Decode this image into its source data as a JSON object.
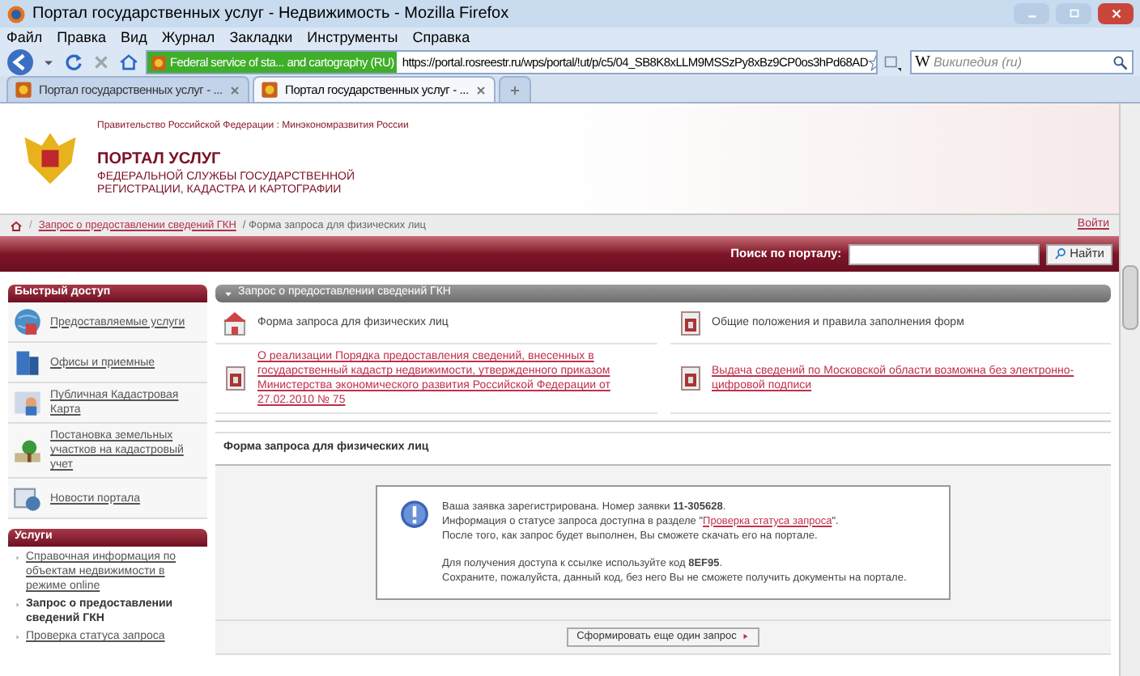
{
  "window": {
    "title": "Портал государственных услуг - Недвижимость - Mozilla Firefox"
  },
  "menu": [
    "Файл",
    "Правка",
    "Вид",
    "Журнал",
    "Закладки",
    "Инструменты",
    "Справка"
  ],
  "navbar": {
    "identity": "Federal service of sta... and cartography (RU)",
    "url": "https://portal.rosreestr.ru/wps/portal/!ut/p/c5/04_SB8K8xLLM9MSSzPy8xBz9CP0os3hPd68AD",
    "search_engine": "W",
    "search_placeholder": "Википедия (ru)"
  },
  "tabs": [
    {
      "label": "Портал государственных услуг - ...",
      "selected": false
    },
    {
      "label": "Портал государственных услуг - ...",
      "selected": true
    }
  ],
  "header": {
    "top_line": "Правительство Российской Федерации : Минэкономразвития России",
    "title": "ПОРТАЛ УСЛУГ",
    "subtitle": "ФЕДЕРАЛЬНОЙ СЛУЖБЫ ГОСУДАРСТВЕННОЙ РЕГИСТРАЦИИ, КАДАСТРА И КАРТОГРАФИИ"
  },
  "breadcrumb": {
    "separator": "/",
    "link": "Запрос о предоставлении сведений ГКН",
    "current": "/ Форма запроса для физических лиц",
    "login": "Войти"
  },
  "portal_search": {
    "label": "Поиск по порталу:",
    "button": "Найти"
  },
  "quick_access": {
    "title": "Быстрый доступ",
    "items": [
      {
        "label": "Предоставляемые услуги",
        "kind": "globe"
      },
      {
        "label": "Офисы и приемные",
        "kind": "building"
      },
      {
        "label": "Публичная Кадастровая Карта",
        "kind": "map"
      },
      {
        "label": "Постановка земельных участков на кадастровый учет",
        "kind": "tree"
      },
      {
        "label": "Новости портала",
        "kind": "news"
      }
    ]
  },
  "services": {
    "title": "Услуги",
    "items": [
      {
        "label": "Справочная информация по объектам недвижимости в режиме online",
        "selected": false
      },
      {
        "label": "Запрос о предоставлении сведений ГКН",
        "selected": true
      },
      {
        "label": "Проверка статуса запроса",
        "selected": false
      }
    ]
  },
  "section": {
    "title": "Запрос о предоставлении сведений ГКН",
    "links": [
      {
        "label": "Форма запроса для физических лиц",
        "kind": "house",
        "link": false
      },
      {
        "label": "Общие положения и правила заполнения форм",
        "kind": "doc",
        "link": false
      },
      {
        "label": "О реализации Порядка предоставления сведений, внесенных в государственный кадастр недвижимости, утвержденного приказом Министерства экономического развития Российской Федерации от 27.02.2010 № 75",
        "kind": "doc",
        "link": true
      },
      {
        "label": "Выдача сведений по Московской области возможна без электронно-цифровой подписи",
        "kind": "doc",
        "link": true
      }
    ]
  },
  "form": {
    "title": "Форма запроса для физических лиц",
    "line_1": "Ваша заявка зарегистрирована. Номер заявки **11-305628**.",
    "line_2_before": "Информация о статусе запроса доступна в разделе \"",
    "line_2_link": "Проверка статуса запроса",
    "line_2_after": "\".",
    "line_3": "После того, как запрос будет выполнен, Вы сможете скачать его на портале.",
    "line_4": "Для получения доступа к ссылке используйте код **8EF95**.",
    "line_5": "Сохраните, пожалуйста, данный код, без него Вы не сможете получить документы на портале.",
    "button": "Сформировать еще один запрос"
  }
}
